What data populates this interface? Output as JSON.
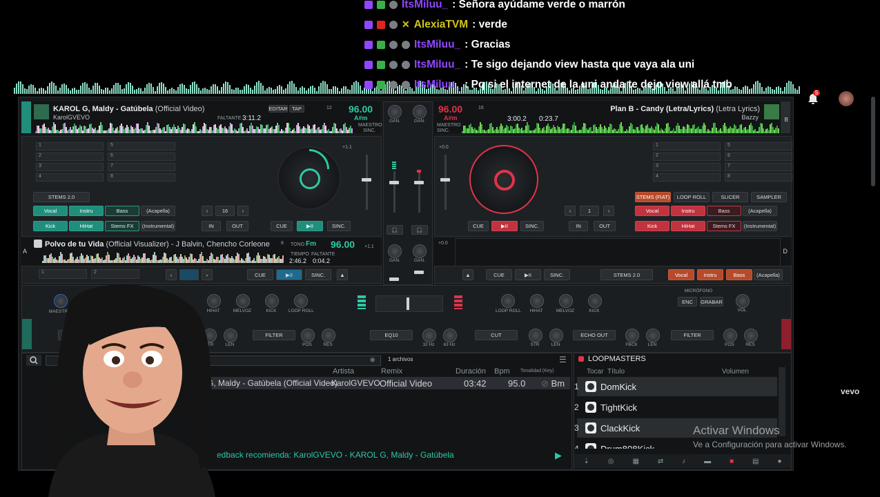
{
  "chat": [
    {
      "user": "ItsMiluu_",
      "color": "#9147ff",
      "text": ": Señora ayúdame verde o marrón"
    },
    {
      "user": "AlexiaTVM",
      "color": "#d4c21c",
      "text": ": verde"
    },
    {
      "user": "ItsMiluu_",
      "color": "#9147ff",
      "text": ": Gracias"
    },
    {
      "user": "ItsMiluu_",
      "color": "#9147ff",
      "text": ": Te sigo dejando view hasta que vaya ala uni"
    },
    {
      "user": "ItsMiluu_",
      "color": "#9147ff",
      "text": ": Pq si el internet de la uni anda te dejo view allá tmb"
    }
  ],
  "notifications": {
    "count": "5"
  },
  "deckA": {
    "letter": "A",
    "title": "KAROL G, Maldy - Gatúbela",
    "title_suffix": "(Official Video)",
    "artist": "KarolGVEVO",
    "bpm": "96.00",
    "remaining_label": "FALTANTE",
    "remaining": "3:11.2",
    "key": "A#m",
    "edit": "EDITAR",
    "tap": "TAP",
    "pitch": "12",
    "master": "MAESTRO",
    "sync_label": "SINC.",
    "cue": "CUE",
    "play": "▶II",
    "sync": "SINC.",
    "loop_size": "16",
    "in": "IN",
    "out": "OUT",
    "stems": "STEMS 2.0",
    "pads": [
      "Vocal",
      "Instru",
      "Bass",
      "(Acapella)",
      "Kick",
      "HiHat",
      "Stems FX",
      "(Instrumental)"
    ],
    "hotcues": [
      "1",
      "2",
      "3",
      "4",
      "5",
      "6",
      "7",
      "8"
    ],
    "pitch_range": "+1.1"
  },
  "deckB": {
    "letter": "B",
    "title": "Plan B - Candy (Letra/Lyrics)",
    "title_suffix": "(Letra Lyrics)",
    "artist": "Bazzy",
    "bpm": "96.00",
    "time1": "3:00.2",
    "time2": "0:23.7",
    "key": "A#m",
    "pitch": "16",
    "master": "MAESTRO",
    "sync_label": "SINC.",
    "cue": "CUE",
    "play": "▶II",
    "sync": "SINC.",
    "loop_size": "1",
    "in": "IN",
    "out": "OUT",
    "stems": "STEMS (FIAT)",
    "loop_roll": "LOOP ROLL",
    "slicer": "SLICER",
    "sampler": "SAMPLER",
    "pads": [
      "Vocal",
      "Instru",
      "Bass",
      "(Acapella)",
      "Kick",
      "HiHat",
      "Stems FX",
      "(Instrumental)"
    ],
    "hotcues": [
      "1",
      "2",
      "3",
      "4",
      "5",
      "6",
      "7",
      "8"
    ],
    "pitch_range": "+0.0"
  },
  "deckC": {
    "letter": "A",
    "title": "Polvo de tu Vida",
    "title_suffix": "(Official Visualizer) - J Balvin, Chencho Corleone",
    "bpm": "96.00",
    "key": "Fm",
    "key_label": "TONO",
    "time_label": "TIEMPO",
    "time": "2:46.2",
    "remaining_label": "FALTANTE",
    "remaining": "0:04.2",
    "pitch": "8",
    "cue": "CUE",
    "play": "▶II",
    "sync": "SINC.",
    "pitch_range": "+1.1"
  },
  "deckD": {
    "letter": "D",
    "cue": "CUE",
    "play": "▶II",
    "sync": "SINC.",
    "stems": "STEMS 2.0",
    "pads": [
      "Vocal",
      "Instru",
      "Bass",
      "(Acapella)"
    ],
    "pitch_range": "+0.0"
  },
  "mixer": {
    "gain": "GAN.",
    "master": "MAESTRO",
    "eq": "EQ10",
    "hz1": "32 Hz",
    "hz2": "63 Hz",
    "mic": "MICRÓFONO",
    "enc": "ENC",
    "record": "GRABAR",
    "vol": "VOL",
    "fx_left": [
      "HIHAT",
      "MELVOZ",
      "KICK",
      "LOOP ROLL"
    ],
    "fx_right": [
      "LOOP ROLL",
      "HIHAT",
      "MELVOZ",
      "KICK"
    ],
    "cut": "CUT",
    "filter": "FILTER",
    "echo": "ECHO OUT",
    "str": "STR",
    "len": "LEN",
    "pos": "POS",
    "res": "RES",
    "fbck": "FBCK"
  },
  "browser": {
    "count": "1 archivos",
    "columns": [
      "Artista",
      "Remix",
      "Duración",
      "Bpm",
      "Tonalidad (Key)"
    ],
    "row": {
      "title": "G, Maldy - Gatúbela (Official Video)",
      "artist": "KarolGVEVO",
      "remix": "Official Video",
      "duration": "03:42",
      "bpm": "95.0",
      "key": "Bm"
    },
    "feedback": "edback recomienda: KarolGVEVO - KAROL G, Maldy - Gatúbela"
  },
  "sampler": {
    "title": "LOOPMASTERS",
    "col_play": "Tocar",
    "col_title": "Título",
    "col_vol": "Volumen",
    "items": [
      {
        "n": "1",
        "name": "DomKick"
      },
      {
        "n": "2",
        "name": "TightKick"
      },
      {
        "n": "3",
        "name": "ClackKick"
      },
      {
        "n": "4",
        "name": "Drum808Kick"
      }
    ]
  },
  "vevo": "vevo",
  "windows": {
    "line1": "Activar Windows",
    "line2": "Ve a Configuración para activar Windows."
  }
}
